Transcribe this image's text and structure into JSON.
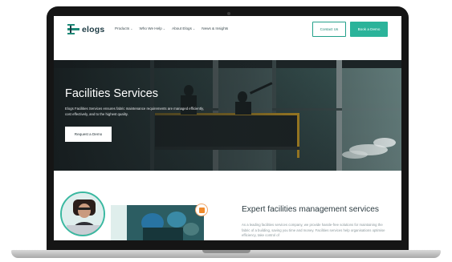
{
  "nav": {
    "logo_text": "elogs",
    "items": [
      {
        "label": "Products",
        "has_dropdown": true
      },
      {
        "label": "Who We Help",
        "has_dropdown": true
      },
      {
        "label": "About Elogs",
        "has_dropdown": true
      },
      {
        "label": "News & Insights",
        "has_dropdown": false
      }
    ],
    "contact_label": "Contact Us",
    "demo_label": "Book a Demo"
  },
  "hero": {
    "title": "Facilities Services",
    "description": "Elogs Facilities Services ensures fabric maintenance requirements are managed efficiently, cost effectively, and to the highest quality.",
    "button_label": "Request a Demo"
  },
  "section": {
    "title": "Expert facilities management services",
    "body": "As a leading facilities services company, we provide hassle-free solutions for maintaining the fabric of a building, saving you time and money. Facilities services help organisations optimise efficiency, take control of"
  },
  "icons": {
    "chevron": "chevron-down-icon",
    "logo": "elogs-logo-icon"
  },
  "colors": {
    "brand": "#2bb39a",
    "brand_dark": "#1d3b44",
    "accent_orange": "#f08a2b",
    "bezel": "#151515"
  }
}
